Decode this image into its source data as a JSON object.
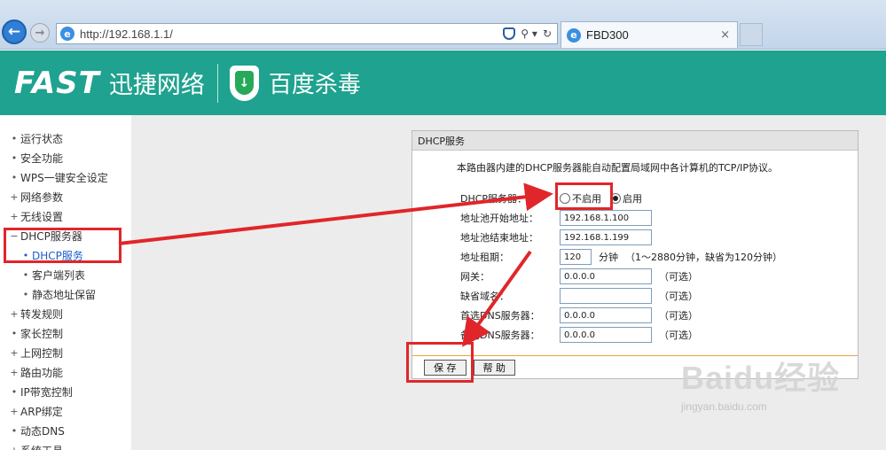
{
  "browser": {
    "url": "http://192.168.1.1/",
    "tab_title": "FBD300",
    "tab_close": "×",
    "back_glyph": "←",
    "forward_glyph": "→",
    "search_glyph": "⚲ ▾",
    "refresh_glyph": "↻",
    "ie_glyph": "e"
  },
  "banner": {
    "brand": "FAST",
    "brand_sub": "迅捷网络",
    "partner": "百度杀毒",
    "bg_color": "#1fa28f"
  },
  "sidebar": {
    "items": [
      {
        "mark": "•",
        "label": "运行状态"
      },
      {
        "mark": "•",
        "label": "安全功能"
      },
      {
        "mark": "•",
        "label": "WPS一键安全设定"
      },
      {
        "mark": "+",
        "label": "网络参数"
      },
      {
        "mark": "+",
        "label": "无线设置"
      },
      {
        "mark": "−",
        "label": "DHCP服务器"
      },
      {
        "mark": "•",
        "label": "DHCP服务"
      },
      {
        "mark": "•",
        "label": "客户端列表"
      },
      {
        "mark": "•",
        "label": "静态地址保留"
      },
      {
        "mark": "+",
        "label": "转发规则"
      },
      {
        "mark": "•",
        "label": "家长控制"
      },
      {
        "mark": "+",
        "label": "上网控制"
      },
      {
        "mark": "+",
        "label": "路由功能"
      },
      {
        "mark": "•",
        "label": "IP带宽控制"
      },
      {
        "mark": "+",
        "label": "ARP绑定"
      },
      {
        "mark": "•",
        "label": "动态DNS"
      },
      {
        "mark": "+",
        "label": "系统工具"
      }
    ]
  },
  "dhcp": {
    "title": "DHCP服务",
    "description": "本路由器内建的DHCP服务器能自动配置局域网中各计算机的TCP/IP协议。",
    "server_label": "DHCP服务器：",
    "option_off": "不启用",
    "option_on": "启用",
    "selected": "启用",
    "start_label": "地址池开始地址：",
    "start_value": "192.168.1.100",
    "end_label": "地址池结束地址：",
    "end_value": "192.168.1.199",
    "lease_label": "地址租期：",
    "lease_value": "120",
    "lease_unit": "分钟",
    "lease_hint": "（1～2880分钟，缺省为120分钟）",
    "gateway_label": "网关：",
    "gateway_value": "0.0.0.0",
    "domain_label": "缺省域名：",
    "domain_value": "",
    "dns1_label": "首选DNS服务器：",
    "dns1_value": "0.0.0.0",
    "dns2_label": "备用DNS服务器：",
    "dns2_value": "0.0.0.0",
    "optional": "（可选）",
    "save": "保 存",
    "help": "帮 助"
  },
  "watermark": {
    "main": "Baidu经验",
    "sub": "jingyan.baidu.com"
  },
  "annotation_color": "#e0262a"
}
